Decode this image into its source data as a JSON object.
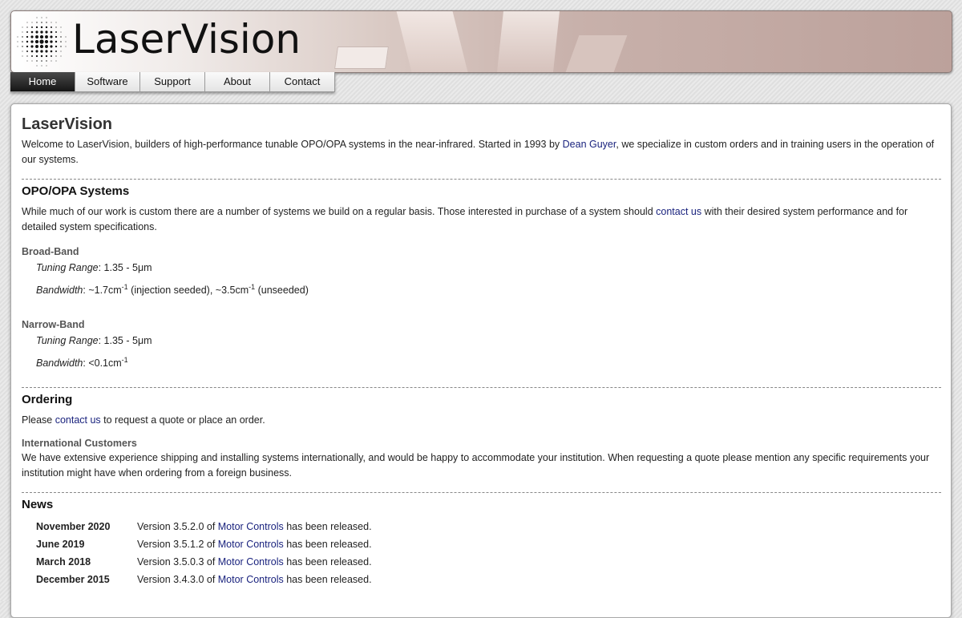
{
  "header": {
    "brand": "LaserVision"
  },
  "nav": {
    "items": [
      "Home",
      "Software",
      "Support",
      "About",
      "Contact"
    ],
    "active": "Home"
  },
  "intro": {
    "title": "LaserVision",
    "text_before": "Welcome to LaserVision, builders of high-performance tunable OPO/OPA systems in the near-infrared. Started in 1993 by ",
    "link": "Dean Guyer",
    "text_after": ", we specialize in custom orders and in training users in the operation of our systems."
  },
  "systems": {
    "title": "OPO/OPA Systems",
    "text_before": "While much of our work is custom there are a number of systems we build on a regular basis. Those interested in purchase of a system should ",
    "link": "contact us",
    "text_after": " with their desired system performance and for detailed system specifications.",
    "broadband": {
      "heading": "Broad-Band",
      "tuning_label": "Tuning Range",
      "tuning_value": ": 1.35 - 5μm",
      "bandwidth_label": "Bandwidth",
      "bw_part1": ": ~1.7cm",
      "bw_exp1": "-1",
      "bw_part2": " (injection seeded), ~3.5cm",
      "bw_exp2": "-1",
      "bw_part3": " (unseeded)"
    },
    "narrowband": {
      "heading": "Narrow-Band",
      "tuning_label": "Tuning Range",
      "tuning_value": ": 1.35 - 5μm",
      "bandwidth_label": "Bandwidth",
      "bw_part1": ": <0.1cm",
      "bw_exp1": "-1"
    }
  },
  "ordering": {
    "title": "Ordering",
    "text_before": "Please ",
    "link": "contact us",
    "text_after": " to request a quote or place an order.",
    "intl_heading": "International Customers",
    "intl_text": "We have extensive experience shipping and installing systems internationally, and would be happy to accommodate your institution. When requesting a quote please mention any specific requirements your institution might have when ordering from a foreign business."
  },
  "news": {
    "title": "News",
    "items": [
      {
        "date": "November 2020",
        "pre": "Version 3.5.2.0 of ",
        "link": "Motor Controls",
        "post": " has been released."
      },
      {
        "date": "June 2019",
        "pre": "Version 3.5.1.2 of ",
        "link": "Motor Controls",
        "post": " has been released."
      },
      {
        "date": "March 2018",
        "pre": "Version 3.5.0.3 of ",
        "link": "Motor Controls",
        "post": " has been released."
      },
      {
        "date": "December 2015",
        "pre": "Version 3.4.3.0 of ",
        "link": "Motor Controls",
        "post": " has been released."
      }
    ]
  }
}
